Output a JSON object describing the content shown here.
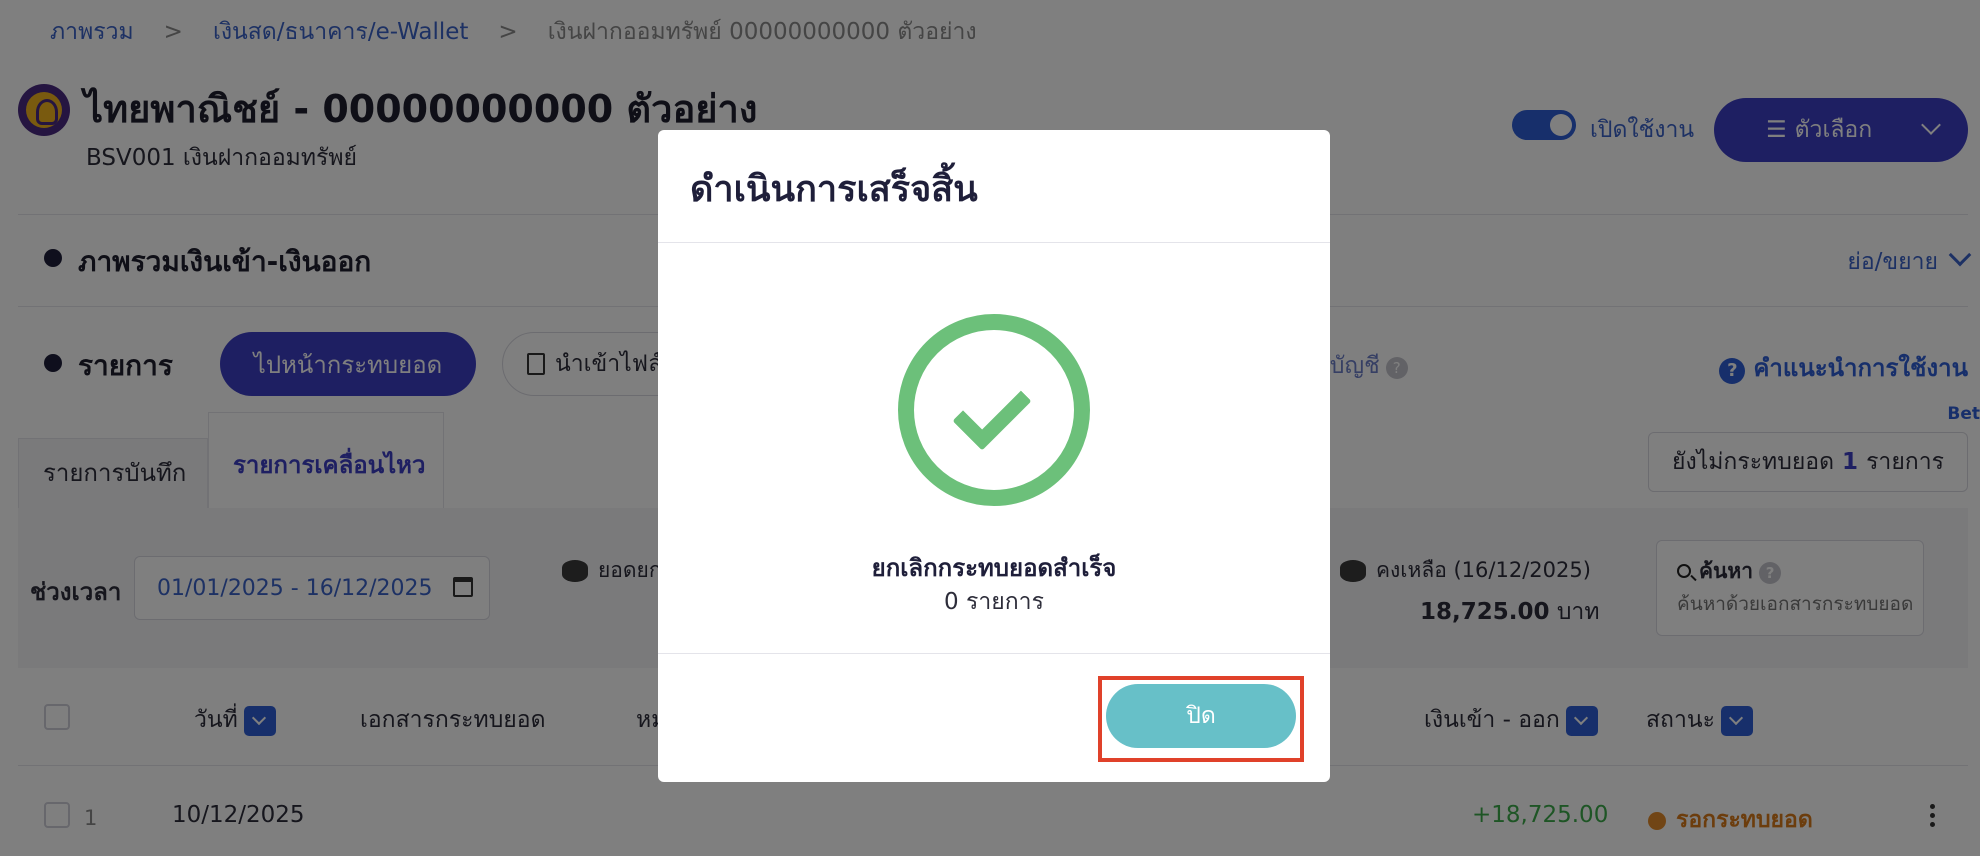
{
  "breadcrumb": {
    "items": [
      "ภาพรวม",
      "เงินสด/ธนาคาร/e-Wallet"
    ],
    "separator": ">",
    "current": "เงินฝากออมทรัพย์ 00000000000 ตัวอย่าง"
  },
  "header": {
    "title": "ไทยพาณิชย์ - 00000000000 ตัวอย่าง",
    "subtitle": "BSV001 เงินฝากออมทรัพย์",
    "toggle_label": "เปิดใช้งาน",
    "toggle_on": true,
    "options_label": "ตัวเลือก"
  },
  "overview": {
    "title": "ภาพรวมเงินเข้า-เงินออก",
    "collapse_label": "ย่อ/ขยาย"
  },
  "list": {
    "title": "รายการ",
    "goto_reconcile_label": "ไปหน้ากระทบยอด",
    "import_label": "นำเข้าไฟล์ธ",
    "account_link_label": "กบัญชี",
    "guide_label": "คำแนะนำการใช้งาน",
    "beta_label": "Bet"
  },
  "tabs": [
    {
      "label": "รายการบันทึก",
      "active": false
    },
    {
      "label": "รายการเคลื่อนไหว",
      "active": true
    }
  ],
  "pending": {
    "prefix": "ยังไม่กระทบยอด",
    "count": "1",
    "suffix": "รายการ"
  },
  "filters": {
    "period_label": "ช่วงเวลา",
    "date_range": "01/01/2025 - 16/12/2025",
    "brought_forward_label": "ยอดยก",
    "balance_label": "คงเหลือ (16/12/2025)",
    "balance_value": "18,725.00",
    "currency": "บาท",
    "search_title": "ค้นหา",
    "search_placeholder": "ค้นหาด้วยเอกสารกระทบยอด"
  },
  "table": {
    "columns": [
      "วันที่",
      "เอกสารกระทบยอด",
      "หม",
      "เงินเข้า - ออก",
      "สถานะ"
    ],
    "rows": [
      {
        "index": "1",
        "date": "10/12/2025",
        "amount": "+18,725.00",
        "status": "รอกระทบยอด"
      }
    ]
  },
  "modal": {
    "title": "ดำเนินการเสร็จสิ้น",
    "message": "ยกเลิกกระทบยอดสำเร็จ",
    "count_text": "0 รายการ",
    "close_label": "ปิด"
  },
  "colors": {
    "primary": "#3d3fc4",
    "link": "#3a62c8",
    "success": "#6cc07a",
    "close_button": "#67c0c8",
    "highlight": "#e0412a",
    "pending_status": "#d97a1a",
    "amount_positive": "#3cab4b"
  }
}
